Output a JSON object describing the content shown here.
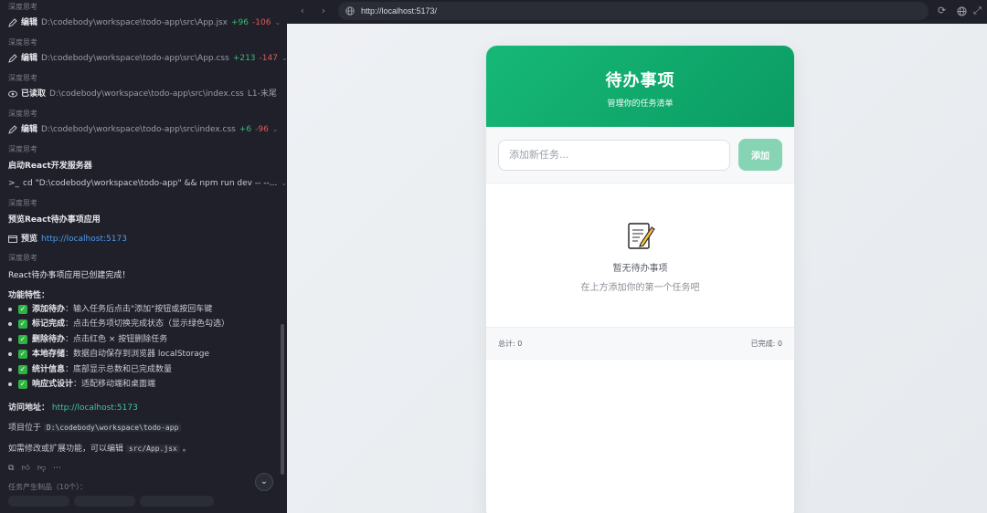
{
  "left_panel": {
    "think_label": "深度思考",
    "ops": [
      {
        "kind": "edit",
        "label": "编辑",
        "path": "D:\\codebody\\workspace\\todo-app\\src\\App.jsx",
        "add": "+96",
        "del": "-106"
      },
      {
        "kind": "edit",
        "label": "编辑",
        "path": "D:\\codebody\\workspace\\todo-app\\src\\App.css",
        "add": "+213",
        "del": "-147"
      },
      {
        "kind": "read",
        "label": "已读取",
        "path": "D:\\codebody\\workspace\\todo-app\\src\\index.css",
        "extra": "L1-末尾"
      },
      {
        "kind": "edit",
        "label": "编辑",
        "path": "D:\\codebody\\workspace\\todo-app\\src\\index.css",
        "add": "+6",
        "del": "-96"
      }
    ],
    "start_server_heading": "启动React开发服务器",
    "command": "cd \"D:\\codebody\\workspace\\todo-app\" && npm run dev -- --...",
    "preview_heading": "预览React待办事项应用",
    "preview_label": "预览",
    "preview_url": "http://localhost:5173",
    "done_message": "React待办事项应用已创建完成！",
    "features_heading": "功能特性：",
    "features": [
      {
        "name": "添加待办",
        "desc": "：输入任务后点击\"添加\"按钮或按回车键"
      },
      {
        "name": "标记完成",
        "desc": "：点击任务项切换完成状态（显示绿色勾选）"
      },
      {
        "name": "删除待办",
        "desc": "：点击红色 × 按钮删除任务"
      },
      {
        "name": "本地存储",
        "desc": "：数据自动保存到浏览器 localStorage"
      },
      {
        "name": "统计信息",
        "desc": "：底部显示总数和已完成数量"
      },
      {
        "name": "响应式设计",
        "desc": "：适配移动端和桌面端"
      }
    ],
    "visit_label": "访问地址：",
    "visit_url": "http://localhost:5173",
    "project_prefix": "项目位于",
    "project_path": "D:\\codebody\\workspace\\todo-app",
    "edit_hint_prefix": "如需修改或扩展功能，可以编辑",
    "edit_hint_file": "src/App.jsx",
    "edit_hint_suffix": "。",
    "artifacts_label": "任务产生制品（10个）："
  },
  "browser": {
    "url": "http://localhost:5173/"
  },
  "app": {
    "title": "待办事项",
    "subtitle": "管理你的任务清单",
    "input_placeholder": "添加新任务...",
    "add_label": "添加",
    "empty_icon": "memo-icon",
    "empty_title": "暂无待办事项",
    "empty_hint": "在上方添加你的第一个任务吧",
    "total_label": "总计: 0",
    "done_label": "已完成: 0"
  },
  "colors": {
    "accent": "#16b877",
    "add_button": "#86d4b3",
    "check": "#2fb344",
    "diff_add": "#3fb87a",
    "diff_del": "#e05a5a",
    "link": "#4c9cf0"
  }
}
